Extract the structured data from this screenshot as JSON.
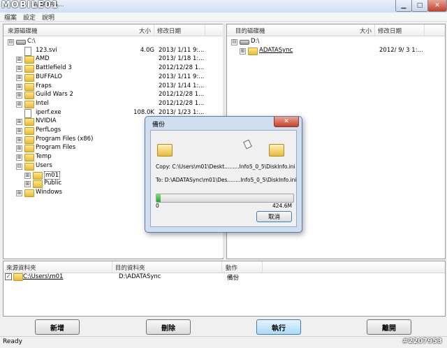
{
  "window": {
    "title": "ADATAS...",
    "logo": "MOBILE01"
  },
  "title_buttons": {
    "minimize": "▁",
    "maximize": "□",
    "close": "✕"
  },
  "menu": [
    "檔案",
    "設定",
    "說明"
  ],
  "left_pane": {
    "headers": [
      "來源磁碟機",
      "大小",
      "修改日期"
    ],
    "rows": [
      {
        "type": "drive",
        "name": "C:\\",
        "size": "",
        "date": "",
        "level": 0,
        "exp": "⊟"
      },
      {
        "type": "file",
        "name": "123.svi",
        "size": "4.0G",
        "date": "2013/ 1/11  9:...",
        "level": 1,
        "exp": ""
      },
      {
        "type": "folder",
        "name": "AMD",
        "size": "",
        "date": "2013/ 1/18  1:...",
        "level": 1,
        "exp": "⊞"
      },
      {
        "type": "folder",
        "name": "Battlefield 3",
        "size": "",
        "date": "2012/12/28  1...",
        "level": 1,
        "exp": "⊞"
      },
      {
        "type": "folder",
        "name": "BUFFALO",
        "size": "",
        "date": "2013/ 1/11  9:...",
        "level": 1,
        "exp": "⊞"
      },
      {
        "type": "folder",
        "name": "Fraps",
        "size": "",
        "date": "2013/ 1/14  1:...",
        "level": 1,
        "exp": "⊞"
      },
      {
        "type": "folder",
        "name": "Guild Wars 2",
        "size": "",
        "date": "2012/12/28  1...",
        "level": 1,
        "exp": "⊞"
      },
      {
        "type": "folder",
        "name": "Intel",
        "size": "",
        "date": "2012/12/28  1...",
        "level": 1,
        "exp": "⊞"
      },
      {
        "type": "file",
        "name": "iperf.exe",
        "size": "108.0K",
        "date": "2013/ 1/23  1:...",
        "level": 1,
        "exp": ""
      },
      {
        "type": "folder",
        "name": "NVIDIA",
        "size": "",
        "date": "",
        "level": 1,
        "exp": "⊞"
      },
      {
        "type": "folder",
        "name": "PerfLogs",
        "size": "",
        "date": "",
        "level": 1,
        "exp": "⊞"
      },
      {
        "type": "folder",
        "name": "Program Files (x86)",
        "size": "",
        "date": "",
        "level": 1,
        "exp": "⊞"
      },
      {
        "type": "folder",
        "name": "Program Files",
        "size": "",
        "date": "",
        "level": 1,
        "exp": "⊞"
      },
      {
        "type": "folder",
        "name": "Temp",
        "size": "",
        "date": "",
        "level": 1,
        "exp": "⊞"
      },
      {
        "type": "folder",
        "name": "Users",
        "size": "",
        "date": "",
        "level": 1,
        "exp": "⊟"
      },
      {
        "type": "folder",
        "name": "m01",
        "size": "",
        "date": "",
        "level": 2,
        "exp": "⊞",
        "selected": true
      },
      {
        "type": "folder",
        "name": "Public",
        "size": "",
        "date": "",
        "level": 2,
        "exp": "⊞"
      },
      {
        "type": "folder",
        "name": "Windows",
        "size": "",
        "date": "",
        "level": 1,
        "exp": "⊞"
      }
    ]
  },
  "right_pane": {
    "headers": [
      "目的磁碟機",
      "大小",
      "修改日期"
    ],
    "rows": [
      {
        "type": "drive",
        "name": "D:\\",
        "size": "",
        "date": "",
        "level": 0,
        "exp": "⊟"
      },
      {
        "type": "folder",
        "name": "ADATASync",
        "size": "",
        "date": "2012/ 9/ 3  1:...",
        "level": 1,
        "exp": "⊞",
        "underline": true
      }
    ]
  },
  "bottom_list": {
    "headers": [
      "來源資料夾",
      "目的資料夾",
      "動作"
    ],
    "rows": [
      {
        "checked": "✓",
        "source": "C:\\Users\\m01",
        "dest": "D:\\ADATASync",
        "action": "備份"
      }
    ]
  },
  "buttons": {
    "add": "新增",
    "delete": "刪除",
    "execute": "執行",
    "exit": "離開"
  },
  "status": "Ready",
  "dialog": {
    "title": "備份",
    "close": "✕",
    "copy_line": "Copy: C:\\Users\\m01\\Deskt.........Info5_0_5\\DiskInfo.ini",
    "to_line": "To: D:\\ADATASync\\m01\\Des........Info5_0_5\\DiskInfo.ini",
    "progress_start": "0",
    "progress_end": "424.6M",
    "progress_fraction": 0.03,
    "cancel": "取消"
  },
  "watermark": "#2207953"
}
